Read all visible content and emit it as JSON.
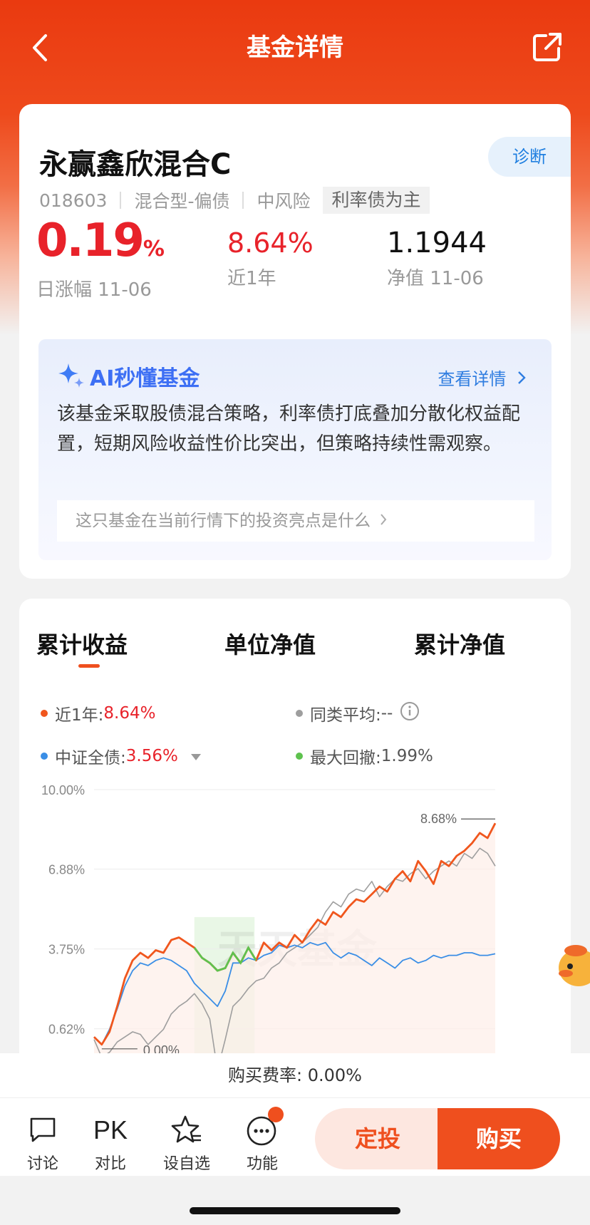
{
  "header": {
    "title": "基金详情"
  },
  "fund": {
    "name": "永赢鑫欣混合C",
    "diagnose_label": "诊断",
    "code": "018603",
    "type": "混合型-偏债",
    "risk": "中风险",
    "tag": "利率债为主",
    "daily_change": "0.19",
    "daily_change_unit": "%",
    "daily_change_label": "日涨幅 11-06",
    "year_return": "8.64%",
    "year_return_label": "近1年",
    "nav": "1.1944",
    "nav_label": "净值 11-06"
  },
  "ai": {
    "title": "AI秒懂基金",
    "more_label": "查看详情",
    "summary": "该基金采取股债混合策略，利率债打底叠加分散化权益配置，短期风险收益性价比突出，但策略持续性需观察。",
    "question": "这只基金在当前行情下的投资亮点是什么"
  },
  "chart_tabs": [
    "累计收益",
    "单位净值",
    "累计净值"
  ],
  "legend": {
    "fund_label": "近1年: ",
    "fund_value": "8.64%",
    "peer_label": "同类平均: ",
    "peer_value": "--",
    "index_label": "中证全债: ",
    "index_value": "3.56%",
    "drawdown_label": "最大回撤: ",
    "drawdown_value": "1.99%"
  },
  "colors": {
    "fund": "#f0561d",
    "index": "#3a8ee6",
    "peer": "#9e9e9e",
    "drawdown": "#5ec24e",
    "accent": "#ef4f1e"
  },
  "chart_data": {
    "type": "line",
    "ylim": [
      -2.5,
      10.0
    ],
    "yticks": [
      "10.00%",
      "6.88%",
      "3.75%",
      "0.62%"
    ],
    "ytick_values": [
      10.0,
      6.88,
      3.75,
      0.62
    ],
    "max_annotation": "8.68%",
    "min_annotation": "0.00%",
    "watermark": "天天基金",
    "drawdown_range": [
      0.25,
      0.4
    ],
    "series": [
      {
        "name": "近1年",
        "values": [
          0.3,
          0.0,
          0.5,
          1.5,
          2.6,
          3.3,
          3.6,
          3.4,
          3.7,
          3.6,
          4.1,
          4.2,
          4.0,
          3.8,
          3.4,
          3.2,
          2.9,
          3.0,
          3.6,
          3.2,
          3.8,
          3.3,
          4.0,
          3.7,
          4.0,
          3.8,
          4.3,
          4.0,
          4.5,
          4.9,
          4.7,
          5.2,
          5.0,
          5.4,
          5.7,
          5.6,
          5.9,
          6.2,
          6.0,
          6.5,
          6.8,
          6.4,
          7.2,
          6.8,
          6.3,
          7.2,
          7.0,
          7.4,
          7.6,
          7.9,
          8.3,
          8.1,
          8.68
        ]
      },
      {
        "name": "中证全债",
        "values": [
          0.3,
          0.0,
          0.6,
          1.4,
          2.3,
          2.9,
          3.2,
          3.1,
          3.3,
          3.4,
          3.3,
          3.1,
          2.9,
          2.4,
          2.1,
          1.8,
          1.5,
          2.1,
          3.2,
          3.2,
          3.4,
          3.3,
          3.5,
          3.6,
          3.9,
          3.8,
          3.9,
          3.8,
          4.0,
          3.9,
          4.0,
          3.6,
          3.4,
          3.6,
          3.5,
          3.3,
          3.1,
          3.4,
          3.2,
          3.0,
          3.3,
          3.4,
          3.2,
          3.3,
          3.5,
          3.4,
          3.5,
          3.5,
          3.6,
          3.6,
          3.5,
          3.5,
          3.56
        ]
      },
      {
        "name": "同类平均",
        "values": [
          0.2,
          -0.5,
          -0.3,
          0.1,
          0.3,
          0.5,
          0.4,
          0.0,
          0.3,
          0.6,
          1.2,
          1.5,
          1.7,
          2.0,
          1.6,
          1.0,
          -1.0,
          0.2,
          1.5,
          1.8,
          2.2,
          2.5,
          2.6,
          3.0,
          3.2,
          3.6,
          3.8,
          4.0,
          4.3,
          4.6,
          5.2,
          5.6,
          5.4,
          5.9,
          6.1,
          6.0,
          6.4,
          5.8,
          6.2,
          6.5,
          6.4,
          6.7,
          6.9,
          6.5,
          6.8,
          7.0,
          7.2,
          7.0,
          7.5,
          7.3,
          7.7,
          7.5,
          7.0
        ]
      }
    ]
  },
  "fee": {
    "label": "购买费率: ",
    "value": "0.00%"
  },
  "bottom": {
    "discuss": "讨论",
    "pk": "PK",
    "compare": "对比",
    "watchlist": "设自选",
    "func": "功能",
    "sip": "定投",
    "buy": "购买"
  }
}
